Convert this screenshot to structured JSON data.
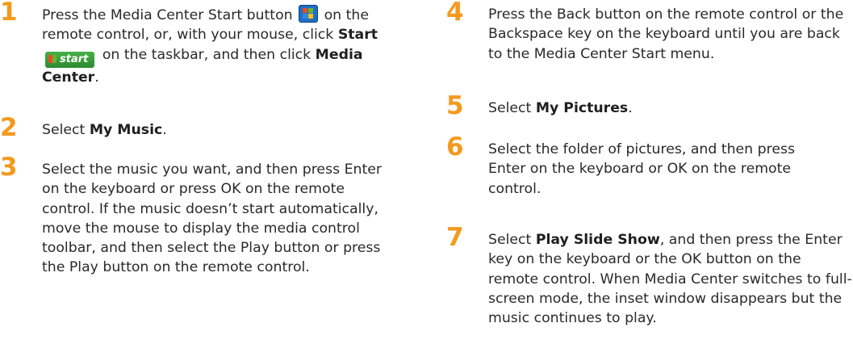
{
  "accent_color": "#f39a1e",
  "left": {
    "step1": {
      "number": "1",
      "text_a": "Press the Media Center Start button",
      "text_b": " on the remote control, or, with your mouse, click ",
      "start_bold": "Start",
      "start_button_label": "start",
      "text_c": " on the taskbar, and then click ",
      "media_center_bold": "Media Center",
      "text_d": "."
    },
    "step2": {
      "number": "2",
      "text_a": "Select ",
      "bold": "My Music",
      "text_b": "."
    },
    "step3": {
      "number": "3",
      "text": "Select the music you want, and then press Enter on the keyboard or press OK on the remote control. If the music doesn’t start automatically, move the mouse to display the media control toolbar, and then select the Play button or press the Play button on the remote control."
    }
  },
  "right": {
    "step4": {
      "number": "4",
      "text": "Press the Back button on the remote control or the Backspace key on the keyboard until you are back to the Media Center Start menu."
    },
    "step5": {
      "number": "5",
      "text_a": "Select ",
      "bold": "My Pictures",
      "text_b": "."
    },
    "step6": {
      "number": "6",
      "text": "Select the folder of pictures, and then press Enter on the keyboard or OK on the remote control."
    },
    "step7": {
      "number": "7",
      "text_a": "Select ",
      "bold": "Play Slide Show",
      "text_b": ", and then press the Enter key on the keyboard or the OK button on the remote control. When Media Center switches to full-screen mode, the inset window disappears but the music continues to play."
    }
  }
}
